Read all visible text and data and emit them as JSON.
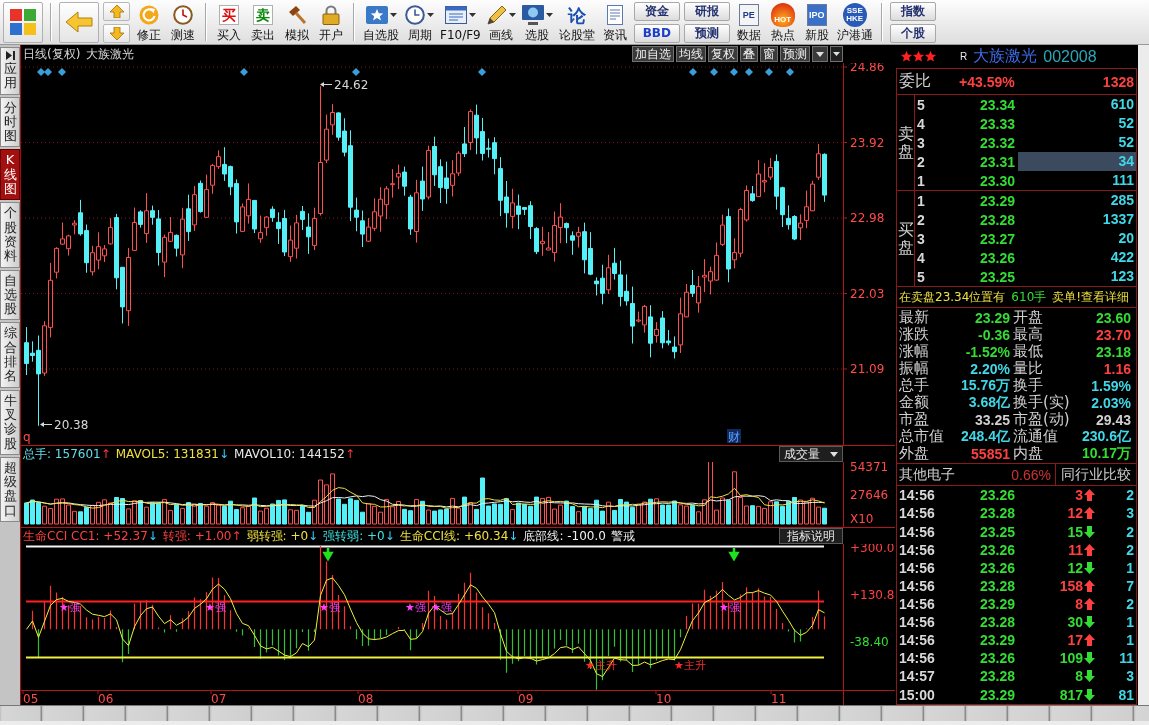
{
  "toolbar": [
    {
      "kind": "icon"
    },
    {
      "kind": "separator"
    },
    {
      "kind": "icon"
    },
    {
      "kind": "arrows"
    },
    {
      "kind": "tool",
      "label": "修正"
    },
    {
      "kind": "tool",
      "label": "测速"
    },
    {
      "kind": "separator"
    },
    {
      "kind": "tool",
      "label": "买入",
      "glyph": "买",
      "color": "#e01010"
    },
    {
      "kind": "tool",
      "label": "卖出",
      "glyph": "卖",
      "color": "#0a8a0a"
    },
    {
      "kind": "tool",
      "label": "模拟"
    },
    {
      "kind": "tool",
      "label": "开户"
    },
    {
      "kind": "separator"
    },
    {
      "kind": "menu",
      "label": "自选股"
    },
    {
      "kind": "menu",
      "label": "周期"
    },
    {
      "kind": "menu",
      "label": "F10/F9"
    },
    {
      "kind": "menu",
      "label": "画线"
    },
    {
      "kind": "menu",
      "label": "选股"
    },
    {
      "kind": "tool",
      "label": "论股堂",
      "glyph": "论",
      "color": "#1a4fb0"
    },
    {
      "kind": "tool",
      "label": "资讯"
    },
    {
      "kind": "stack",
      "buttons": [
        {
          "label": "资金"
        },
        {
          "label": "BBD",
          "color": "#1c3fc8"
        }
      ]
    },
    {
      "kind": "stack",
      "buttons": [
        {
          "label": "研报"
        },
        {
          "label": "预测"
        }
      ]
    },
    {
      "kind": "tool",
      "label": "数据",
      "glyph": "PE"
    },
    {
      "kind": "tool",
      "label": "热点",
      "glyph": "HOT"
    },
    {
      "kind": "tool",
      "label": "新股",
      "glyph": "IPO"
    },
    {
      "kind": "tool",
      "label": "沪港通",
      "glyph": "SSE HKE"
    },
    {
      "kind": "separator"
    },
    {
      "kind": "stack",
      "buttons": [
        {
          "label": "指数"
        },
        {
          "label": "个股"
        }
      ]
    }
  ],
  "side_tabs": [
    {
      "label": "应用",
      "selected": false
    },
    {
      "label": "分时图",
      "selected": false
    },
    {
      "label": "K线图",
      "selected": true
    },
    {
      "label": "个股资料",
      "selected": false
    },
    {
      "label": "自选股",
      "selected": false
    },
    {
      "label": "综合排名",
      "selected": false
    },
    {
      "label": "牛叉诊股",
      "selected": false
    },
    {
      "label": "超级盘口",
      "selected": false
    }
  ],
  "chart": {
    "period": "日线(复权)",
    "stock": "大族激光",
    "buttons": [
      "加自选",
      "均线",
      "复权",
      "叠",
      "窗",
      "预测"
    ],
    "price_axis": [
      "24.86",
      "23.92",
      "22.98",
      "22.03",
      "21.09"
    ],
    "high_label": "24.62",
    "low_label": "20.38",
    "corner_mark": "q",
    "finance_mark": "财"
  },
  "volume": {
    "legend": [
      {
        "label": "总手:",
        "value": "157601",
        "arrow": "↑",
        "rising": true,
        "color": "#62dcea"
      },
      {
        "label": "MAVOL5:",
        "value": "131831",
        "arrow": "↓",
        "rising": false,
        "color": "#f0e040"
      },
      {
        "label": "MAVOL10:",
        "value": "144152",
        "arrow": "↑",
        "rising": true,
        "color": "#e8e8e8"
      }
    ],
    "selector": "成交量",
    "axis": [
      "54371",
      "27646",
      "X10"
    ]
  },
  "indicator": {
    "legend": [
      {
        "label": "生命CCI CC1:",
        "value": "+52.37",
        "arrow": "↓",
        "rising": false,
        "color": "#ff4040"
      },
      {
        "label": "转强:",
        "value": "+1.00",
        "arrow": "↑",
        "rising": true,
        "color": "#ff4040"
      },
      {
        "label": "弱转强:",
        "value": "+0",
        "arrow": "↓",
        "rising": false,
        "color": "#f0e040"
      },
      {
        "label": "强转弱:",
        "value": "+0",
        "arrow": "↓",
        "rising": false,
        "color": "#40e0e0"
      },
      {
        "label": "生命CCI线:",
        "value": "+60.34",
        "arrow": "↓",
        "rising": false,
        "color": "#f0e040"
      },
      {
        "label": "底部线:",
        "value": "-100.0",
        "color": "#f0f0f0"
      },
      {
        "label": "警戒",
        "color": "#f0f0f0"
      }
    ],
    "help_button": "指标说明",
    "axis": [
      {
        "text": "+300.0",
        "color": "#ff4040"
      },
      {
        "text": "+130.8",
        "color": "#ff4040"
      },
      {
        "text": "-38.40",
        "color": "#30e030"
      }
    ],
    "signals": [
      {
        "label": "★强",
        "kind": "strong"
      },
      {
        "label": "★强",
        "kind": "strong"
      },
      {
        "label": "★强",
        "kind": "strong"
      },
      {
        "label": "★强",
        "kind": "strong"
      },
      {
        "label": "★强",
        "kind": "strong"
      },
      {
        "label": "★强",
        "kind": "strong"
      },
      {
        "label": "★主升",
        "kind": "rise"
      },
      {
        "label": "★主升",
        "kind": "rise"
      }
    ]
  },
  "dates": [
    "05",
    "06",
    "07",
    "08",
    "09",
    "10",
    "11"
  ],
  "quote": {
    "stars": 3,
    "prefix": "R",
    "name": "大族激光",
    "code": "002008",
    "ratio": {
      "label": "委比",
      "percent": "+43.59%",
      "difference": "1328"
    },
    "sell": {
      "label": "卖盘",
      "rows": [
        {
          "rank": "5",
          "price": "23.34",
          "volume": "610",
          "selected": false
        },
        {
          "rank": "4",
          "price": "23.33",
          "volume": "52",
          "selected": false
        },
        {
          "rank": "3",
          "price": "23.32",
          "volume": "52",
          "selected": false
        },
        {
          "rank": "2",
          "price": "23.31",
          "volume": "34",
          "selected": true
        },
        {
          "rank": "1",
          "price": "23.30",
          "volume": "111",
          "selected": false
        }
      ]
    },
    "buy": {
      "label": "买盘",
      "rows": [
        {
          "rank": "1",
          "price": "23.29",
          "volume": "285",
          "selected": false
        },
        {
          "rank": "2",
          "price": "23.28",
          "volume": "1337",
          "selected": false
        },
        {
          "rank": "3",
          "price": "23.27",
          "volume": "20",
          "selected": false
        },
        {
          "rank": "4",
          "price": "23.26",
          "volume": "422",
          "selected": false
        },
        {
          "rank": "5",
          "price": "23.25",
          "volume": "123",
          "selected": false
        }
      ]
    },
    "notice": {
      "text": "在卖盘23.34位置有",
      "volume": "610手",
      "action": "卖单!查看详细"
    },
    "stats": [
      {
        "label": "最新",
        "value": "23.29",
        "color": "#33dd33"
      },
      {
        "label": "开盘",
        "value": "23.60",
        "color": "#33dd33"
      },
      {
        "label": "涨跌",
        "value": "-0.36",
        "color": "#33dd33"
      },
      {
        "label": "最高",
        "value": "23.70",
        "color": "#ff4040"
      },
      {
        "label": "涨幅",
        "value": "-1.52%",
        "color": "#33dd33"
      },
      {
        "label": "最低",
        "value": "23.18",
        "color": "#33dd33"
      },
      {
        "label": "振幅",
        "value": "2.20%",
        "color": "#40d8e8"
      },
      {
        "label": "量比",
        "value": "1.16",
        "color": "#ff4040"
      },
      {
        "label": "总手",
        "value": "15.76万",
        "color": "#40d8e8"
      },
      {
        "label": "换手",
        "value": "1.59%",
        "color": "#40d8e8"
      },
      {
        "label": "金额",
        "value": "3.68亿",
        "color": "#40d8e8"
      },
      {
        "label": "换手(实)",
        "value": "2.03%",
        "color": "#40d8e8"
      },
      {
        "label": "市盈",
        "value": "33.25",
        "color": "#d0d0d0"
      },
      {
        "label": "市盈(动)",
        "value": "29.43",
        "color": "#d0d0d0"
      },
      {
        "label": "总市值",
        "value": "248.4亿",
        "color": "#40d8e8"
      },
      {
        "label": "流通值",
        "value": "230.6亿",
        "color": "#40d8e8"
      },
      {
        "label": "外盘",
        "value": "55851",
        "color": "#ff4040"
      },
      {
        "label": "内盘",
        "value": "10.17万",
        "color": "#33dd33"
      }
    ],
    "sector": {
      "name": "其他电子",
      "change": "0.66%",
      "button": "同行业比较"
    },
    "ticks": [
      {
        "time": "14:56",
        "price": "23.26",
        "volume": "3",
        "rising": true,
        "count": "2"
      },
      {
        "time": "14:56",
        "price": "23.28",
        "volume": "12",
        "rising": true,
        "count": "3"
      },
      {
        "time": "14:56",
        "price": "23.25",
        "volume": "15",
        "rising": false,
        "count": "2"
      },
      {
        "time": "14:56",
        "price": "23.26",
        "volume": "11",
        "rising": true,
        "count": "2"
      },
      {
        "time": "14:56",
        "price": "23.26",
        "volume": "12",
        "rising": false,
        "count": "1"
      },
      {
        "time": "14:56",
        "price": "23.28",
        "volume": "158",
        "rising": true,
        "count": "7"
      },
      {
        "time": "14:56",
        "price": "23.29",
        "volume": "8",
        "rising": true,
        "count": "2"
      },
      {
        "time": "14:56",
        "price": "23.28",
        "volume": "30",
        "rising": false,
        "count": "1"
      },
      {
        "time": "14:56",
        "price": "23.29",
        "volume": "17",
        "rising": true,
        "count": "1"
      },
      {
        "time": "14:56",
        "price": "23.26",
        "volume": "109",
        "rising": false,
        "count": "11"
      },
      {
        "time": "14:57",
        "price": "23.28",
        "volume": "8",
        "rising": false,
        "count": "3"
      },
      {
        "time": "15:00",
        "price": "23.29",
        "volume": "817",
        "rising": false,
        "count": "81"
      }
    ]
  }
}
